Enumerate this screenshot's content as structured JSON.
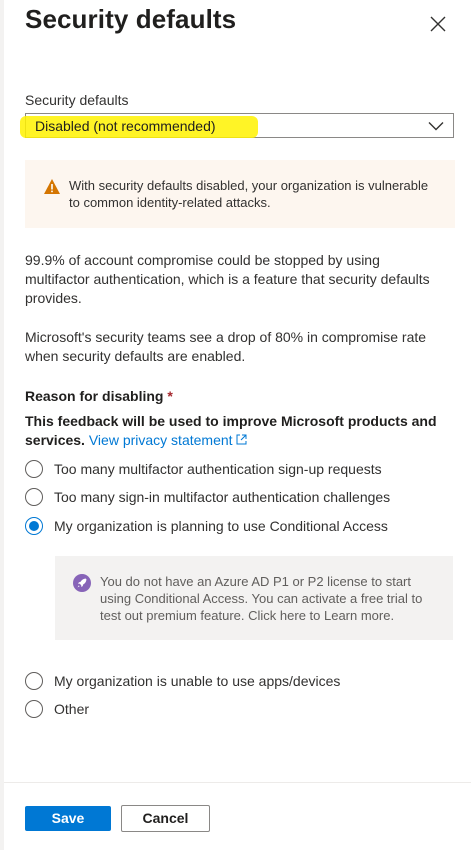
{
  "panel": {
    "title": "Security defaults",
    "close_icon": "close-icon"
  },
  "security_defaults": {
    "label": "Security defaults",
    "selected": "Disabled (not recommended)",
    "highlight_color": "#fff200"
  },
  "warning": {
    "icon": "warning-icon",
    "text": "With security defaults disabled, your organization is vulnerable to common identity-related attacks.",
    "background": "#fdf6ef",
    "icon_color": "#d47500"
  },
  "paragraphs": {
    "p1": "99.9% of account compromise could be stopped by using multifactor authentication, which is a feature that security defaults provides.",
    "p2": "Microsoft's security teams see a drop of 80% in compromise rate when security defaults are enabled."
  },
  "reason": {
    "label": "Reason for disabling",
    "required_mark": "*",
    "feedback_text": "This feedback will be used to improve Microsoft products and services.",
    "privacy_link": "View privacy statement",
    "options": [
      {
        "label": "Too many multifactor authentication sign-up requests",
        "checked": false
      },
      {
        "label": "Too many sign-in multifactor authentication challenges",
        "checked": false
      },
      {
        "label": "My organization is planning to use Conditional Access",
        "checked": true
      },
      {
        "label": "My organization is unable to use apps/devices",
        "checked": false
      },
      {
        "label": "Other",
        "checked": false
      }
    ]
  },
  "info": {
    "icon": "rocket-icon",
    "text": "You do not have an Azure AD P1 or P2 license to start using Conditional Access. You can activate a free trial to test out premium feature. Click here to Learn more.",
    "icon_color": "#8764b8"
  },
  "footer": {
    "save_label": "Save",
    "cancel_label": "Cancel",
    "accent": "#0078d4"
  }
}
